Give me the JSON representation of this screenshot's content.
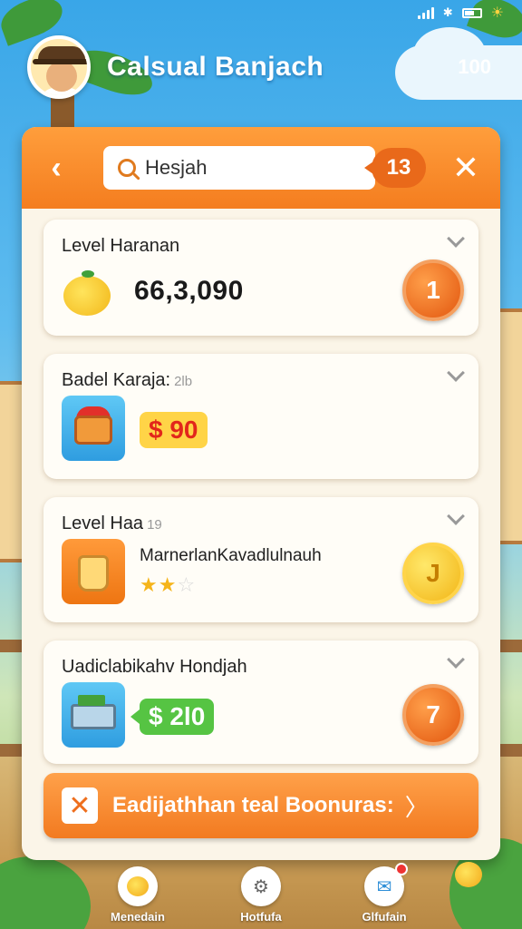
{
  "header": {
    "app_title": "Calsual Banjach",
    "coin_count": "100"
  },
  "search": {
    "value": "Hesjah",
    "result_count": "13"
  },
  "cards": [
    {
      "title": "Level Haranan",
      "title_suffix": "",
      "value": "66,3,090",
      "icon": "mango-icon",
      "badge": "1"
    },
    {
      "title": "Badel Karaja:",
      "title_suffix": "2lb",
      "icon": "treasure-chest-icon",
      "price": "$ 90"
    },
    {
      "title": "Level Haa",
      "title_suffix": "19",
      "icon": "gift-bag-icon",
      "item_name": "MarnerlanKavadlulnauh",
      "stars": "★★☆",
      "rating": 2,
      "badge": "J"
    },
    {
      "title": "Uadiclabikahv Hondjah",
      "title_suffix": "",
      "icon": "cash-register-icon",
      "price": "$ 2l0",
      "badge": "7"
    }
  ],
  "bonus_button": {
    "label": "Eadijathhan teal Boonuras:",
    "chevron": "〉"
  },
  "nav": [
    {
      "label": "Menedain",
      "icon": "mango-icon"
    },
    {
      "label": "Hotfufa",
      "icon": "gear-icon"
    },
    {
      "label": "Glfufain",
      "icon": "chat-icon"
    }
  ],
  "colors": {
    "accent_orange": "#f47d1f",
    "panel_bg": "#fbf5e8",
    "price_yellow": "#ffd447",
    "price_green": "#56c443"
  }
}
